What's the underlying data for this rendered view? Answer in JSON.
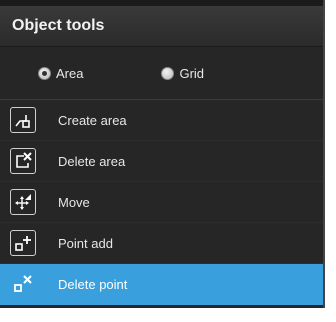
{
  "panel": {
    "title": "Object tools"
  },
  "modes": [
    {
      "label": "Area",
      "selected": true
    },
    {
      "label": "Grid",
      "selected": false
    }
  ],
  "tools": [
    {
      "label": "Create area",
      "icon": "create-area-icon",
      "selected": false
    },
    {
      "label": "Delete area",
      "icon": "delete-area-icon",
      "selected": false
    },
    {
      "label": "Move",
      "icon": "move-icon",
      "selected": false
    },
    {
      "label": "Point add",
      "icon": "point-add-icon",
      "selected": false
    },
    {
      "label": "Delete point",
      "icon": "delete-point-icon",
      "selected": true
    }
  ],
  "colors": {
    "panel_bg": "#262626",
    "selected_bg": "#3aa0dd",
    "text": "#e6e6e6"
  }
}
